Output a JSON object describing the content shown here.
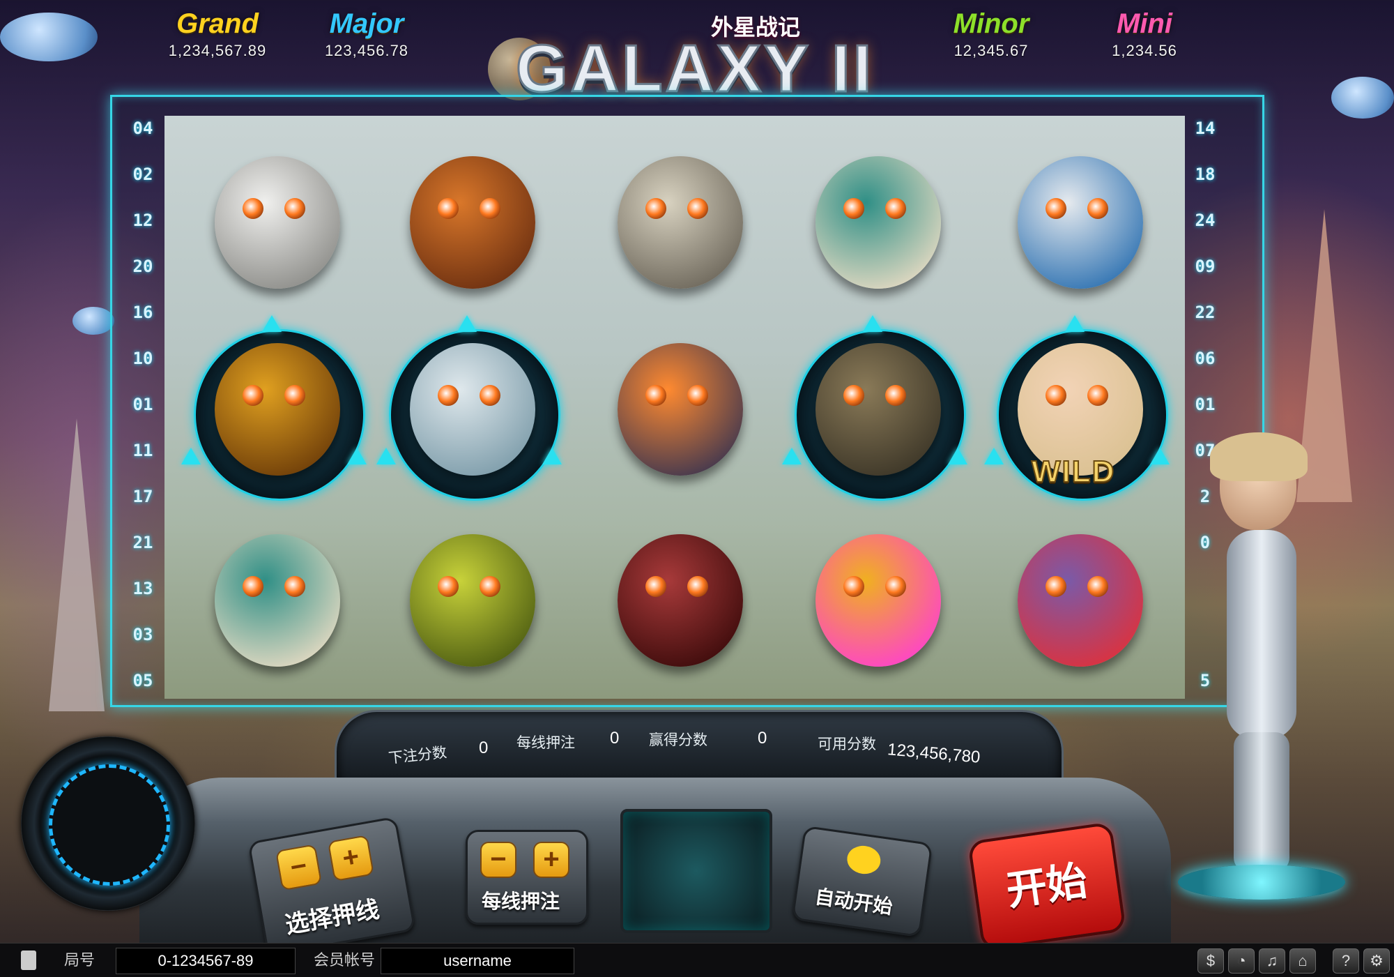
{
  "game": {
    "logo_main": "GALAXY II",
    "logo_sub": "外星战记"
  },
  "jackpots": [
    {
      "label": "Grand",
      "value": "1,234,567.89",
      "color": "#ffd21f"
    },
    {
      "label": "Major",
      "value": "123,456.78",
      "color": "#33c8ff"
    },
    {
      "label": "Minor",
      "value": "12,345.67",
      "color": "#8de02a"
    },
    {
      "label": "Mini",
      "value": "1,234.56",
      "color": "#ff5ab0"
    }
  ],
  "paylines": {
    "left": [
      "04",
      "02",
      "12",
      "20",
      "16",
      "10",
      "01",
      "11",
      "17",
      "21",
      "13",
      "03",
      "05"
    ],
    "right": [
      "14",
      "18",
      "24",
      "09",
      "22",
      "06",
      "01",
      "07",
      "2",
      "0",
      "",
      "",
      "5"
    ]
  },
  "reels": {
    "rows": [
      [
        "yeti-helmet-creature",
        "armored-orange-beast",
        "jar-brain-robot",
        "green-dome-frog",
        "energy-cannon"
      ],
      [
        "orange-bell-robot",
        "glass-egg-pod",
        "flame-tentacle-creature",
        "rock-golem",
        "wild-girl"
      ],
      [
        "green-dome-frog",
        "yellow-spore-creature",
        "red-eye-slug",
        "pink-spark-yellow-blob",
        "purple-mouth-monster"
      ]
    ],
    "wild_label": "WILD"
  },
  "hud": {
    "bet_label": "下注分数",
    "bet_value": "0",
    "line_bet_label": "每线押注",
    "line_bet_value": "0",
    "win_label": "赢得分数",
    "win_value": "0",
    "credit_label": "可用分数",
    "credit_value": "123,456,780"
  },
  "controls": {
    "select_lines_label": "选择押线",
    "line_bet_label": "每线押注",
    "auto_start_label": "自动开始",
    "start_label": "开始",
    "minus": "−",
    "plus": "+"
  },
  "status": {
    "round_label": "局号",
    "round_value": "0-1234567-89",
    "account_label": "会员帐号",
    "account_value": "username",
    "icons": [
      "cashier-icon",
      "rss-icon",
      "music-icon",
      "home-icon",
      "help-icon",
      "settings-icon"
    ]
  },
  "colors": {
    "accent_cyan": "#36d6e6",
    "start_red": "#e0201a"
  }
}
